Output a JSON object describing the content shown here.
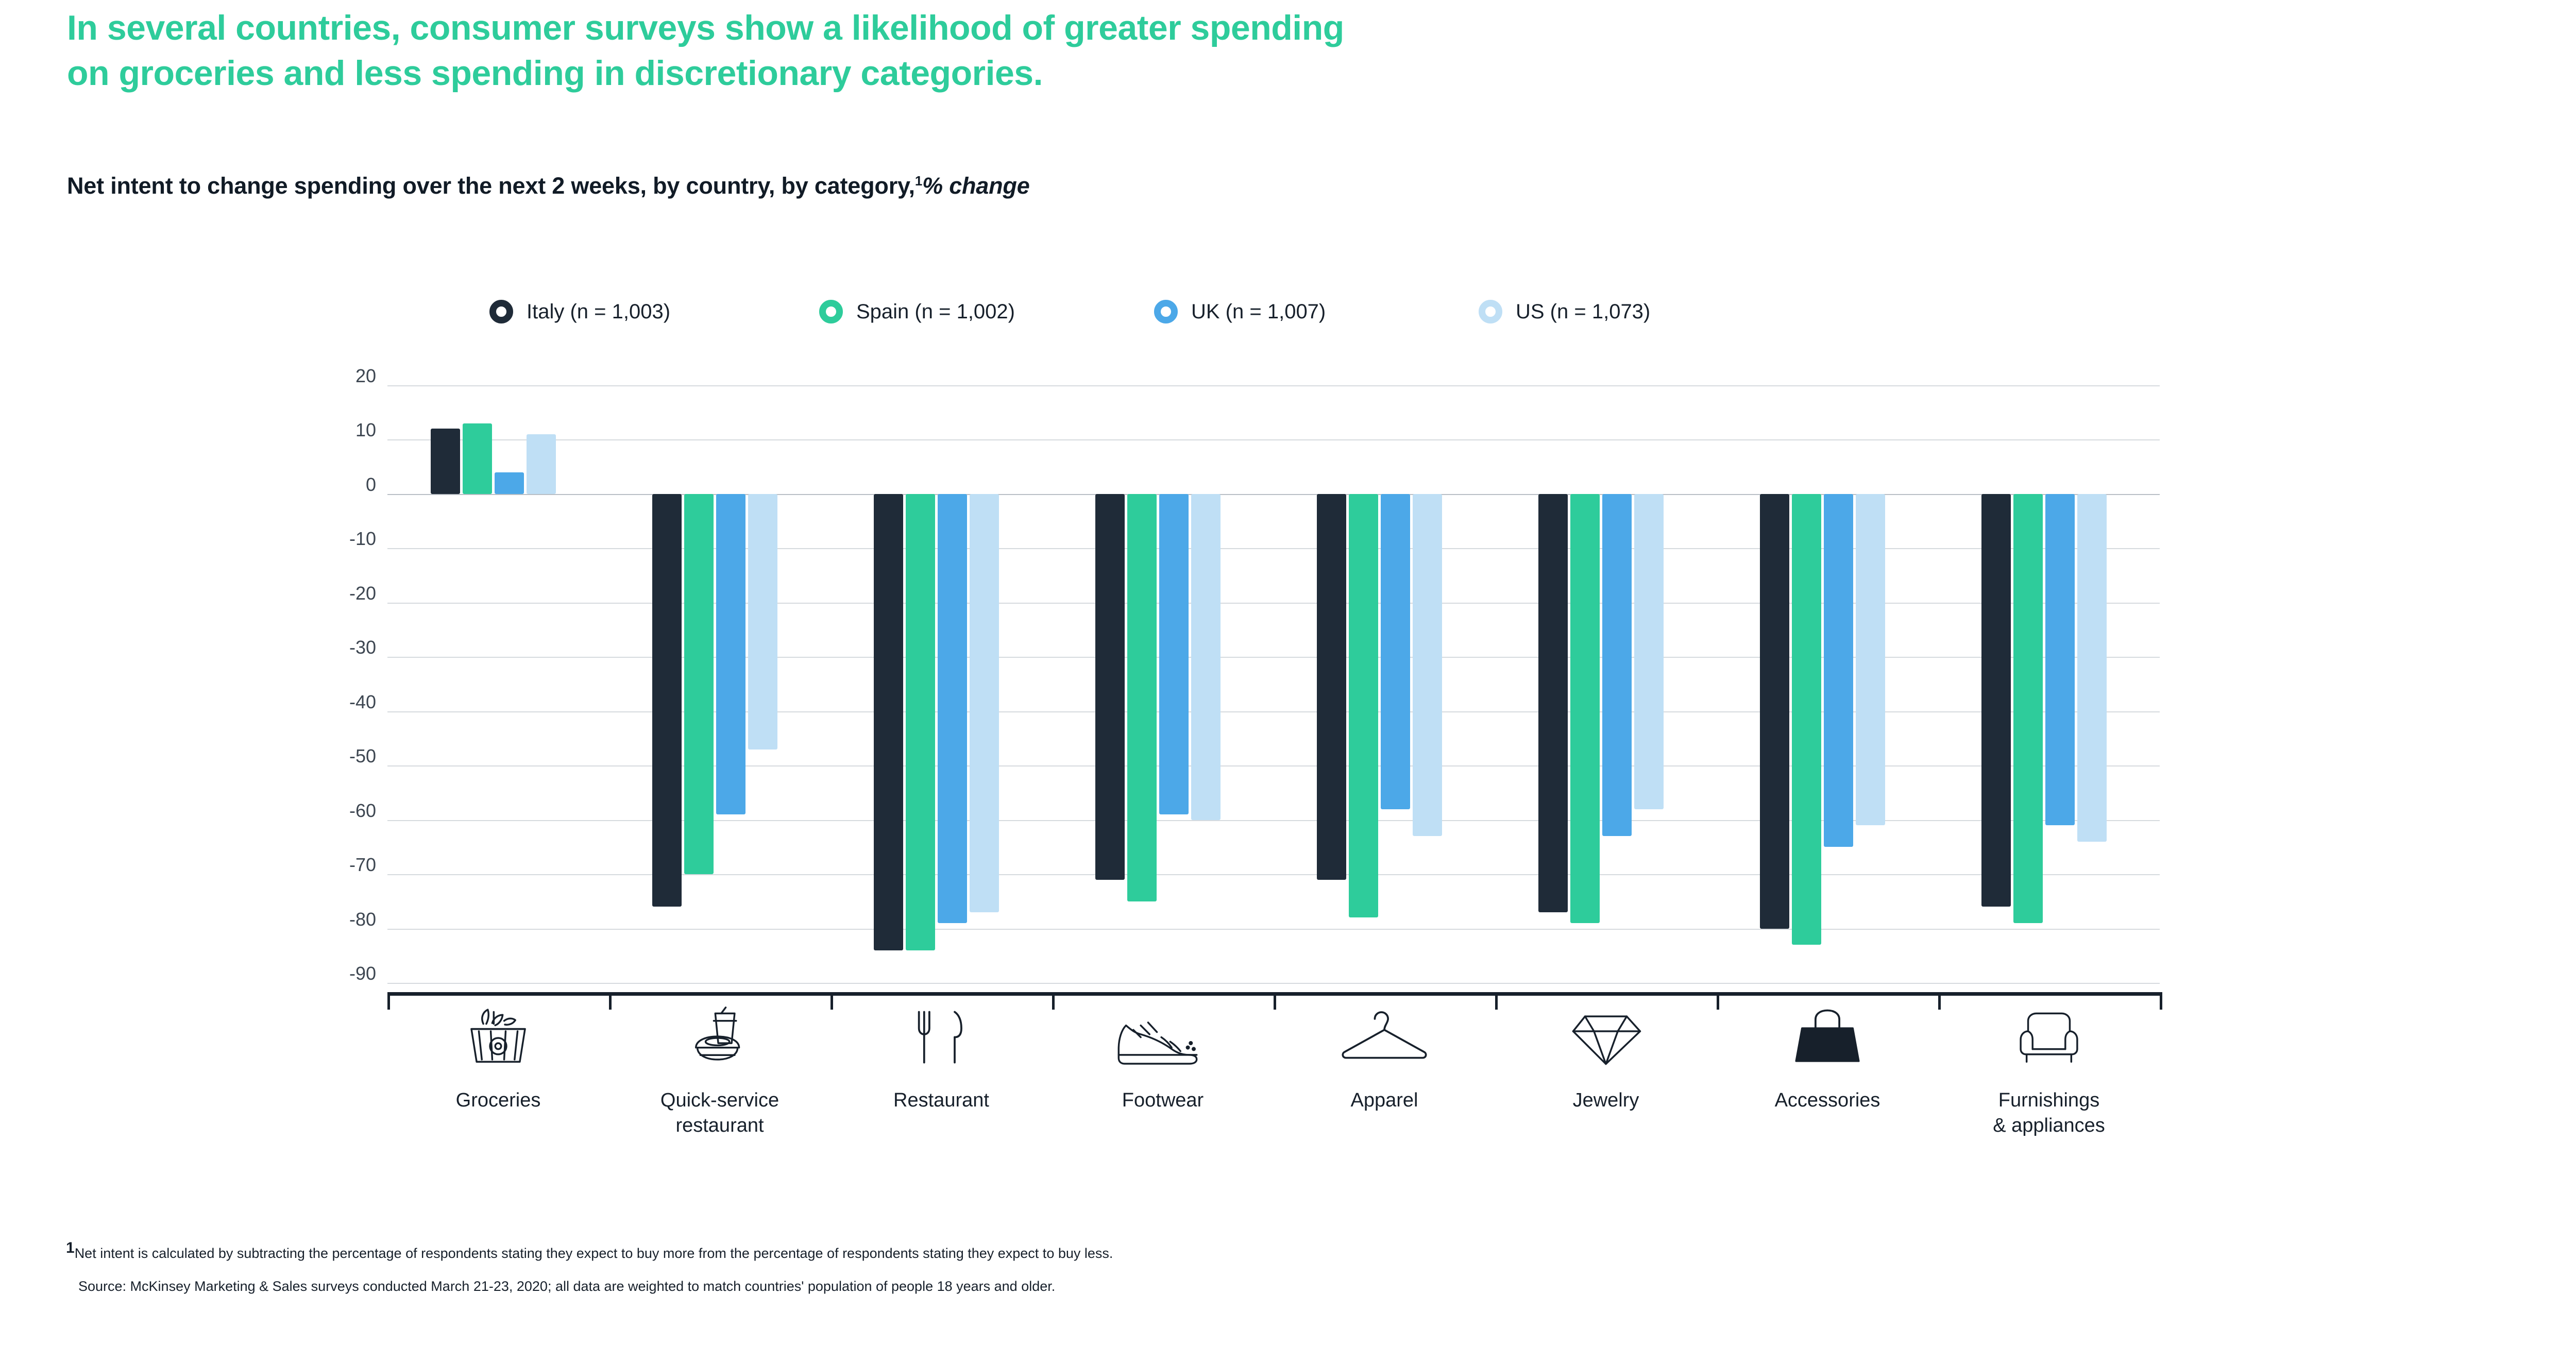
{
  "headline": {
    "line1": "In several countries, consumer surveys show a likelihood of greater spending",
    "line2": "on groceries and less spending in discretionary categories."
  },
  "subtitle": {
    "main": "Net intent to change spending over the next 2 weeks, by country, by category,",
    "footnote_marker": "1",
    "unit": "% change"
  },
  "legend": [
    {
      "label": "Italy (n = 1,003)",
      "color": "#1f2b38",
      "icon": "circle-outline-icon"
    },
    {
      "label": "Spain (n = 1,002)",
      "color": "#2ECC9B",
      "icon": "circle-outline-icon"
    },
    {
      "label": "UK (n = 1,007)",
      "color": "#4CA8E8",
      "icon": "circle-outline-icon"
    },
    {
      "label": "US (n = 1,073)",
      "color": "#BFDFF5",
      "icon": "circle-outline-icon"
    }
  ],
  "footnotes": {
    "marker": "1",
    "note": "Net intent is calculated by subtracting the percentage of respondents stating they expect to buy more from the percentage of respondents stating they expect to buy less.",
    "source": "Source: McKinsey Marketing & Sales surveys conducted March 21-23, 2020; all data are weighted to match countries' population of people 18 years and older."
  },
  "category_icons": [
    "grocery-basket-icon",
    "fast-food-cup-icon",
    "fork-knife-icon",
    "sneaker-icon",
    "clothes-hanger-icon",
    "diamond-icon",
    "handbag-icon",
    "armchair-icon"
  ],
  "chart_data": {
    "type": "bar",
    "title": "Net intent to change spending over the next 2 weeks, by country, by category",
    "subtitle": "% change",
    "xlabel": "",
    "ylabel": "% change",
    "ylim": [
      -90,
      20
    ],
    "yticks": [
      20,
      10,
      0,
      -10,
      -20,
      -30,
      -40,
      -50,
      -60,
      -70,
      -80,
      -90
    ],
    "ytick_labels": [
      "20",
      "10",
      "0",
      "-10",
      "-20",
      "-30",
      "-40",
      "-50",
      "-60",
      "-70",
      "-80",
      "-90"
    ],
    "grid": true,
    "legend_position": "top",
    "categories": [
      "Groceries",
      "Quick-service restaurant",
      "Restaurant",
      "Footwear",
      "Apparel",
      "Jewelry",
      "Accessories",
      "Furnishings & appliances"
    ],
    "category_labels": [
      [
        "Groceries"
      ],
      [
        "Quick-service",
        "restaurant"
      ],
      [
        "Restaurant"
      ],
      [
        "Footwear"
      ],
      [
        "Apparel"
      ],
      [
        "Jewelry"
      ],
      [
        "Accessories"
      ],
      [
        "Furnishings",
        "& appliances"
      ]
    ],
    "series": [
      {
        "name": "Italy (n = 1,003)",
        "color": "#1f2b38",
        "values": [
          12,
          -76,
          -84,
          -71,
          -71,
          -77,
          -80,
          -76
        ]
      },
      {
        "name": "Spain (n = 1,002)",
        "color": "#2ECC9B",
        "values": [
          13,
          -70,
          -84,
          -75,
          -78,
          -79,
          -83,
          -79
        ]
      },
      {
        "name": "UK (n = 1,007)",
        "color": "#4CA8E8",
        "values": [
          4,
          -59,
          -79,
          -59,
          -58,
          -63,
          -65,
          -61
        ]
      },
      {
        "name": "US (n = 1,073)",
        "color": "#BFDFF5",
        "values": [
          11,
          -47,
          -77,
          -60,
          -63,
          -58,
          -61,
          -64
        ]
      }
    ]
  }
}
